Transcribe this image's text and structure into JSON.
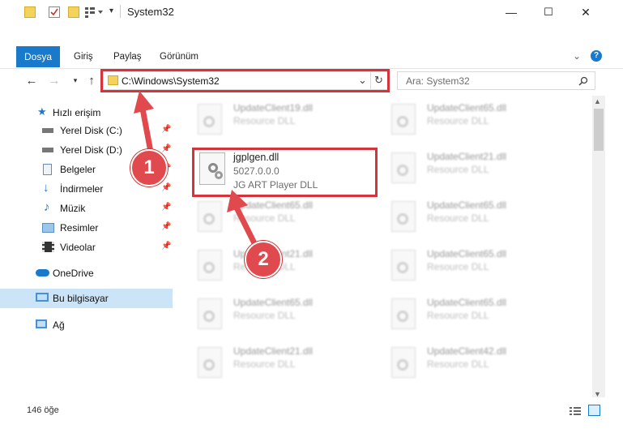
{
  "window": {
    "title": "System32",
    "controls": {
      "minimize": "—",
      "maximize": "☐",
      "close": "✕"
    }
  },
  "ribbon": {
    "tabs": [
      "Dosya",
      "Giriş",
      "Paylaş",
      "Görünüm"
    ],
    "expand_icon": "chevron-down-icon",
    "help_label": "?"
  },
  "address": {
    "path": "C:\\Windows\\System32",
    "search_placeholder": "Ara: System32"
  },
  "sidebar": {
    "quick_access": "Hızlı erişim",
    "items": [
      {
        "label": "Yerel Disk (C:)",
        "icon": "drive-icon",
        "pinned": true
      },
      {
        "label": "Yerel Disk (D:)",
        "icon": "drive-icon",
        "pinned": true
      },
      {
        "label": "Belgeler",
        "icon": "documents-icon",
        "pinned": true
      },
      {
        "label": "İndirmeler",
        "icon": "download-icon",
        "pinned": true
      },
      {
        "label": "Müzik",
        "icon": "music-icon",
        "pinned": true
      },
      {
        "label": "Resimler",
        "icon": "pictures-icon",
        "pinned": true
      },
      {
        "label": "Videolar",
        "icon": "videos-icon",
        "pinned": true
      }
    ],
    "onedrive": "OneDrive",
    "this_pc": "Bu bilgisayar",
    "network": "Ağ"
  },
  "files": {
    "selected": {
      "name": "jgplgen.dll",
      "version": "5027.0.0.0",
      "description": "JG ART Player DLL"
    },
    "background": [
      {
        "name": "UpdateClient19.dll",
        "type": "Resource DLL"
      },
      {
        "name": "UpdateClient65.dll",
        "type": "Resource DLL"
      },
      {
        "name": "UpdateClient21.dll",
        "type": "Resource DLL"
      },
      {
        "name": "UpdateClient65.dll",
        "type": "Resource DLL"
      },
      {
        "name": "UpdateClient65.dll",
        "type": "Resource DLL"
      },
      {
        "name": "UpdateClient21.dll",
        "type": "Resource DLL"
      },
      {
        "name": "UpdateClient65.dll",
        "type": "Resource DLL"
      },
      {
        "name": "UpdateClient65.dll",
        "type": "Resource DLL"
      },
      {
        "name": "UpdateClient65.dll",
        "type": "Resource DLL"
      },
      {
        "name": "UpdateClient21.dll",
        "type": "Resource DLL"
      },
      {
        "name": "UpdateClient42.dll",
        "type": "Resource DLL"
      }
    ]
  },
  "status": {
    "count": "146 öğe"
  },
  "annotations": {
    "step1": "1",
    "step2": "2",
    "color": "#d6343a"
  }
}
